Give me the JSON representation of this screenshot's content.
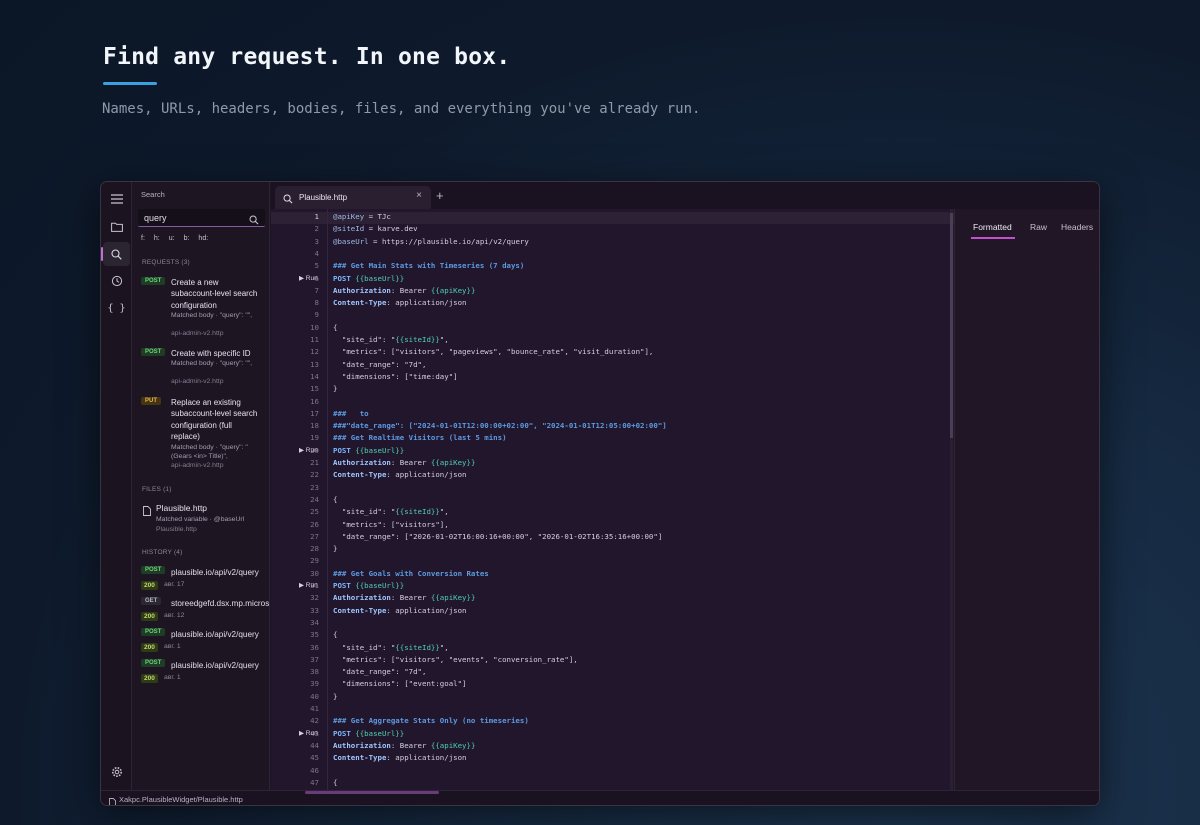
{
  "hero": {
    "title": "Find any request. In one box.",
    "subtitle": "Names, URLs, headers, bodies, files, and everything you've already run."
  },
  "colors": {
    "accent": "#3aa0e0",
    "active_tab_underline": "#c24fd0",
    "post_method": "#6ed07a",
    "put_method": "#e6b34a",
    "status_ok": "#c3d96a"
  },
  "activity_bar": {
    "icons": [
      "menu-icon",
      "folder-icon",
      "search-icon",
      "history-icon",
      "braces-icon"
    ],
    "active": "search-icon",
    "settings_icon": "gear-icon"
  },
  "sidebar": {
    "title": "Search",
    "search_value": "query",
    "filters": [
      "f:",
      "h:",
      "u:",
      "b:",
      "hd:"
    ],
    "requests_header": "REQUESTS (3)",
    "requests": [
      {
        "method": "POST",
        "title": "Create a new subaccount-level search configuration",
        "match": "Matched body · \"query\": \"\",",
        "file": "api-admin-v2.http"
      },
      {
        "method": "POST",
        "title": "Create with specific ID",
        "match": "Matched body · \"query\": \"\",",
        "file": "api-admin-v2.http"
      },
      {
        "method": "PUT",
        "title": "Replace an existing subaccount-level search configuration (full replace)",
        "match": "Matched body · \"query\": \"(Gears <in> Title)\",",
        "file": "api-admin-v2.http"
      }
    ],
    "files_header": "FILES (1)",
    "files": [
      {
        "name": "Plausible.http",
        "match": "Matched variable · @baseUrl",
        "file": "Plausible.http"
      }
    ],
    "history_header": "HISTORY (4)",
    "history": [
      {
        "method": "POST",
        "url": "plausible.io/api/v2/query",
        "status": "200",
        "date": "авг. 17"
      },
      {
        "method": "GET",
        "url": "storeedgefd.dsx.mp.microsoft.com",
        "status": "200",
        "date": "авг. 12"
      },
      {
        "method": "POST",
        "url": "plausible.io/api/v2/query",
        "status": "200",
        "date": "авг. 1"
      },
      {
        "method": "POST",
        "url": "plausible.io/api/v2/query",
        "status": "200",
        "date": "авг. 1"
      }
    ]
  },
  "tabs": {
    "active_label": "Plausible.http",
    "close": "×",
    "add": "+"
  },
  "editor": {
    "run_label": "▶ Run",
    "current_line": 1,
    "lines": [
      {
        "n": "1",
        "text": "@apiKey = TJc"
      },
      {
        "n": "2",
        "text": "@siteId = karve.dev"
      },
      {
        "n": "3",
        "text": "@baseUrl = https://plausible.io/api/v2/query"
      },
      {
        "n": "4",
        "text": ""
      },
      {
        "n": "5",
        "text": "### Get Main Stats with Timeseries (7 days)"
      },
      {
        "n": "6",
        "text": "POST {{baseUrl}}",
        "run": true
      },
      {
        "n": "7",
        "text": "Authorization: Bearer {{apiKey}}"
      },
      {
        "n": "8",
        "text": "Content-Type: application/json"
      },
      {
        "n": "9",
        "text": ""
      },
      {
        "n": "10",
        "text": "{"
      },
      {
        "n": "11",
        "text": "  \"site_id\": \"{{siteId}}\","
      },
      {
        "n": "12",
        "text": "  \"metrics\": [\"visitors\", \"pageviews\", \"bounce_rate\", \"visit_duration\"],"
      },
      {
        "n": "13",
        "text": "  \"date_range\": \"7d\","
      },
      {
        "n": "14",
        "text": "  \"dimensions\": [\"time:day\"]"
      },
      {
        "n": "15",
        "text": "}"
      },
      {
        "n": "16",
        "text": ""
      },
      {
        "n": "17",
        "text": "###   to"
      },
      {
        "n": "18",
        "text": "###\"date_range\": [\"2024-01-01T12:00:00+02:00\", \"2024-01-01T12:05:00+02:00\"]"
      },
      {
        "n": "19",
        "text": "### Get Realtime Visitors (last 5 mins)"
      },
      {
        "n": "20",
        "text": "POST {{baseUrl}}",
        "run": true
      },
      {
        "n": "21",
        "text": "Authorization: Bearer {{apiKey}}"
      },
      {
        "n": "22",
        "text": "Content-Type: application/json"
      },
      {
        "n": "23",
        "text": ""
      },
      {
        "n": "24",
        "text": "{"
      },
      {
        "n": "25",
        "text": "  \"site_id\": \"{{siteId}}\","
      },
      {
        "n": "26",
        "text": "  \"metrics\": [\"visitors\"],"
      },
      {
        "n": "27",
        "text": "  \"date_range\": [\"2026-01-02T16:00:16+00:00\", \"2026-01-02T16:35:16+00:00\"]"
      },
      {
        "n": "28",
        "text": "}"
      },
      {
        "n": "29",
        "text": ""
      },
      {
        "n": "30",
        "text": "### Get Goals with Conversion Rates"
      },
      {
        "n": "31",
        "text": "POST {{baseUrl}}",
        "run": true
      },
      {
        "n": "32",
        "text": "Authorization: Bearer {{apiKey}}"
      },
      {
        "n": "33",
        "text": "Content-Type: application/json"
      },
      {
        "n": "34",
        "text": ""
      },
      {
        "n": "35",
        "text": "{"
      },
      {
        "n": "36",
        "text": "  \"site_id\": \"{{siteId}}\","
      },
      {
        "n": "37",
        "text": "  \"metrics\": [\"visitors\", \"events\", \"conversion_rate\"],"
      },
      {
        "n": "38",
        "text": "  \"date_range\": \"7d\","
      },
      {
        "n": "39",
        "text": "  \"dimensions\": [\"event:goal\"]"
      },
      {
        "n": "40",
        "text": "}"
      },
      {
        "n": "41",
        "text": ""
      },
      {
        "n": "42",
        "text": "### Get Aggregate Stats Only (no timeseries)"
      },
      {
        "n": "43",
        "text": "POST {{baseUrl}}",
        "run": true
      },
      {
        "n": "44",
        "text": "Authorization: Bearer {{apiKey}}"
      },
      {
        "n": "45",
        "text": "Content-Type: application/json"
      },
      {
        "n": "46",
        "text": ""
      },
      {
        "n": "47",
        "text": "{"
      }
    ]
  },
  "response_panel": {
    "tabs": [
      "Formatted",
      "Raw",
      "Headers"
    ],
    "active": "Formatted"
  },
  "status_bar": {
    "path": "Xakpc.PlausibleWidget/Plausible.http"
  }
}
